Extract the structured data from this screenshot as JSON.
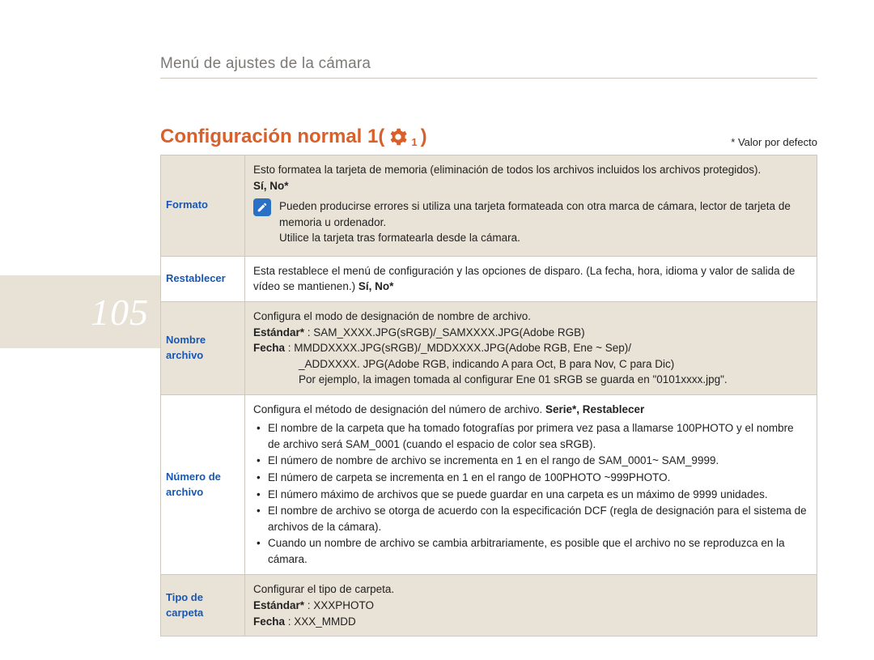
{
  "page_number": "105",
  "breadcrumb": "Menú de ajustes de la cámara",
  "title_prefix": "Configuración normal 1(",
  "title_gear_sub": "1",
  "title_suffix": " )",
  "default_note": "* Valor por defecto",
  "rows": {
    "formato": {
      "label": "Formato",
      "intro": "Esto formatea la tarjeta de memoria (eliminación de todos los archivos incluidos los archivos protegidos).",
      "options_bold": "Sí, No*",
      "note1": "Pueden producirse errores si utiliza una tarjeta formateada con otra marca de cámara, lector de tarjeta de memoria u ordenador.",
      "note2": "Utilice la tarjeta tras formatearla desde la cámara."
    },
    "restablecer": {
      "label": "Restablecer",
      "text_a": "Esta restablece el menú de configuración y las opciones de disparo.  (La fecha, hora, idioma y valor de salida de vídeo se mantienen.) ",
      "text_bold": "Sí, No*"
    },
    "nombre": {
      "label": "Nombre archivo",
      "line1": "Configura el modo de designación de nombre de archivo.",
      "estandar_label": "Estándar*",
      "estandar_value": " : SAM_XXXX.JPG(sRGB)/_SAMXXXX.JPG(Adobe RGB)",
      "fecha_label": "Fecha",
      "fecha_value": " : MMDDXXXX.JPG(sRGB)/_MDDXXXX.JPG(Adobe RGB, Ene ~ Sep)/",
      "fecha_line2": "_ADDXXXX. JPG(Adobe RGB, indicando A para Oct, B para Nov, C para Dic)",
      "fecha_line3": "Por ejemplo, la imagen tomada al configurar Ene 01 sRGB se guarda en \"0101xxxx.jpg\"."
    },
    "numero": {
      "label": "Número de archivo",
      "intro_a": "Configura el método de designación del número de archivo. ",
      "intro_bold": "Serie*, Restablecer",
      "b1": "El nombre de la carpeta que ha tomado fotografías por primera vez pasa a llamarse 100PHOTO y el nombre de archivo será SAM_0001 (cuando el espacio de color sea sRGB).",
      "b2": "El número de nombre de archivo se incrementa en 1 en el rango de SAM_0001~ SAM_9999.",
      "b3": "El número de carpeta se incrementa en 1 en el rango de 100PHOTO ~999PHOTO.",
      "b4": "El número máximo de archivos que se puede guardar en una carpeta es un máximo de 9999 unidades.",
      "b5": "El nombre de archivo se otorga de acuerdo con la especificación DCF (regla de designación para el sistema de archivos de la cámara).",
      "b6": "Cuando un nombre de archivo se cambia arbitrariamente, es posible que el archivo no se reproduzca en la cámara."
    },
    "tipo": {
      "label": "Tipo de carpeta",
      "line1": "Configurar el tipo de carpeta.",
      "estandar_label": "Estándar*",
      "estandar_value": " : XXXPHOTO",
      "fecha_label": "Fecha",
      "fecha_value": " : XXX_MMDD"
    }
  }
}
